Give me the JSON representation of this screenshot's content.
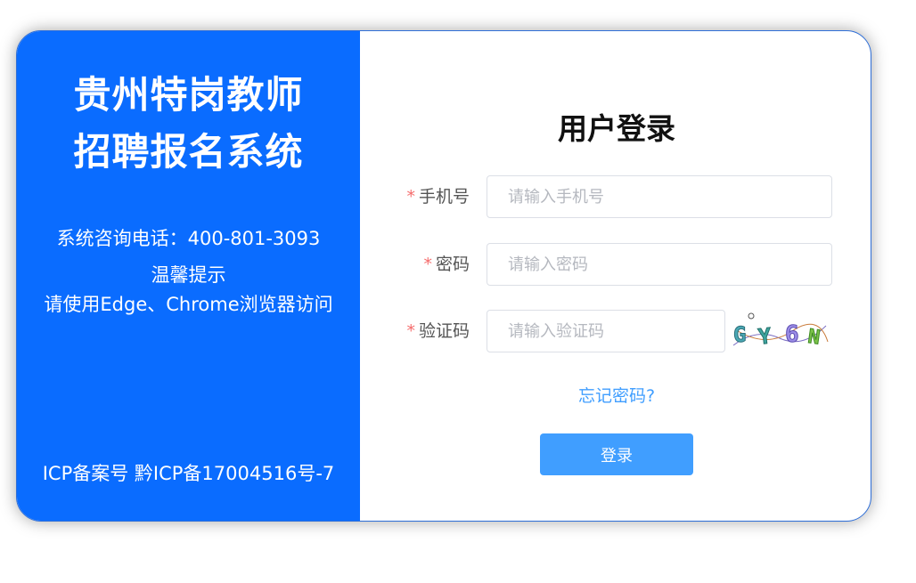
{
  "brand": {
    "title_line1": "贵州特岗教师",
    "title_line2": "招聘报名系统",
    "hotline": "系统咨询电话：400-801-3093",
    "tips_title": "温馨提示",
    "tips_text": "请使用Edge、Chrome浏览器访问",
    "icp": "ICP备案号 黔ICP备17004516号-7"
  },
  "login": {
    "title": "用户登录",
    "required_mark": "*",
    "phone": {
      "label": "手机号",
      "placeholder": "请输入手机号",
      "value": ""
    },
    "password": {
      "label": "密码",
      "placeholder": "请输入密码",
      "value": ""
    },
    "captcha": {
      "label": "验证码",
      "placeholder": "请输入验证码",
      "value": "",
      "image_text": "GY6N"
    },
    "forgot_link": "忘记密码?",
    "submit_label": "登录"
  },
  "colors": {
    "brand_blue": "#0a6cff",
    "button_blue": "#409eff",
    "required_red": "#f56c6c"
  }
}
